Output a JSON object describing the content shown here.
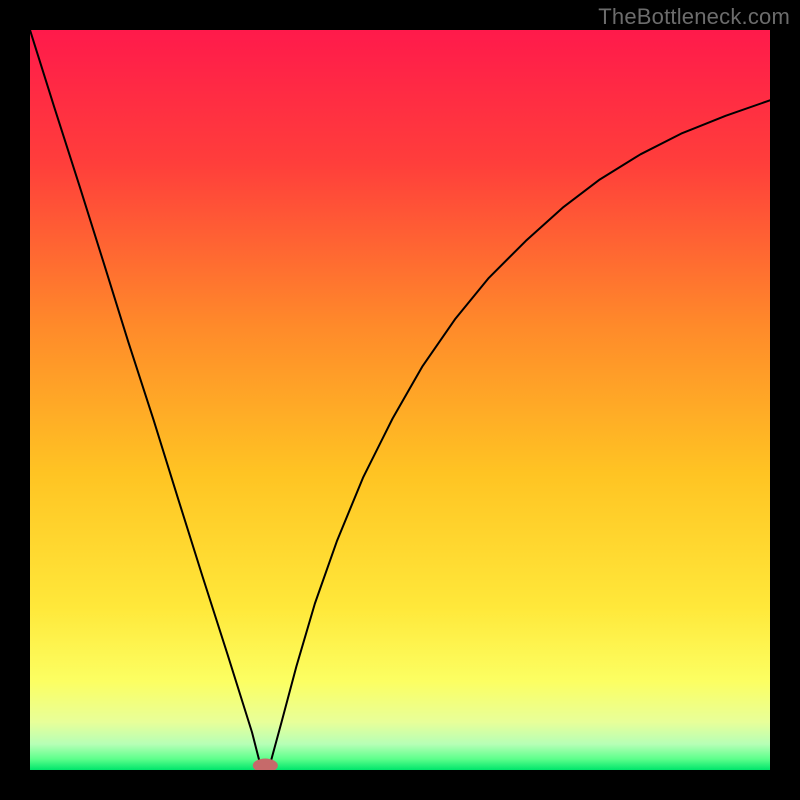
{
  "watermark": "TheBottleneck.com",
  "chart_data": {
    "type": "line",
    "title": "",
    "xlabel": "",
    "ylabel": "",
    "xlim": [
      0,
      100
    ],
    "ylim": [
      0,
      100
    ],
    "gradient_stops": [
      {
        "offset": 0.0,
        "color": "#ff1a4b"
      },
      {
        "offset": 0.18,
        "color": "#ff3e3b"
      },
      {
        "offset": 0.4,
        "color": "#ff8a2a"
      },
      {
        "offset": 0.6,
        "color": "#ffc423"
      },
      {
        "offset": 0.78,
        "color": "#ffe83a"
      },
      {
        "offset": 0.88,
        "color": "#fcff62"
      },
      {
        "offset": 0.935,
        "color": "#e8ff99"
      },
      {
        "offset": 0.965,
        "color": "#b6ffb6"
      },
      {
        "offset": 0.985,
        "color": "#5eff8c"
      },
      {
        "offset": 1.0,
        "color": "#00e56b"
      }
    ],
    "series": [
      {
        "name": "left-arm",
        "stroke": "#000000",
        "stroke_width": 2,
        "x": [
          0.0,
          3.3,
          6.7,
          10.0,
          13.3,
          16.7,
          20.0,
          23.3,
          26.7,
          30.0,
          31.0
        ],
        "y": [
          100.0,
          89.5,
          78.9,
          68.4,
          57.8,
          47.3,
          36.7,
          26.2,
          15.6,
          5.1,
          1.2
        ]
      },
      {
        "name": "right-arm",
        "stroke": "#000000",
        "stroke_width": 2,
        "x": [
          32.5,
          34.0,
          36.0,
          38.5,
          41.5,
          45.0,
          49.0,
          53.0,
          57.5,
          62.0,
          67.0,
          72.0,
          77.0,
          82.5,
          88.0,
          94.0,
          100.0
        ],
        "y": [
          1.0,
          6.5,
          14.0,
          22.5,
          31.0,
          39.5,
          47.5,
          54.5,
          61.0,
          66.5,
          71.5,
          76.0,
          79.8,
          83.2,
          86.0,
          88.4,
          90.5
        ]
      }
    ],
    "marker": {
      "name": "bottleneck-indicator",
      "cx": 31.8,
      "cy": 0.6,
      "rx": 1.7,
      "ry": 0.95,
      "fill": "#c66a6a"
    }
  }
}
